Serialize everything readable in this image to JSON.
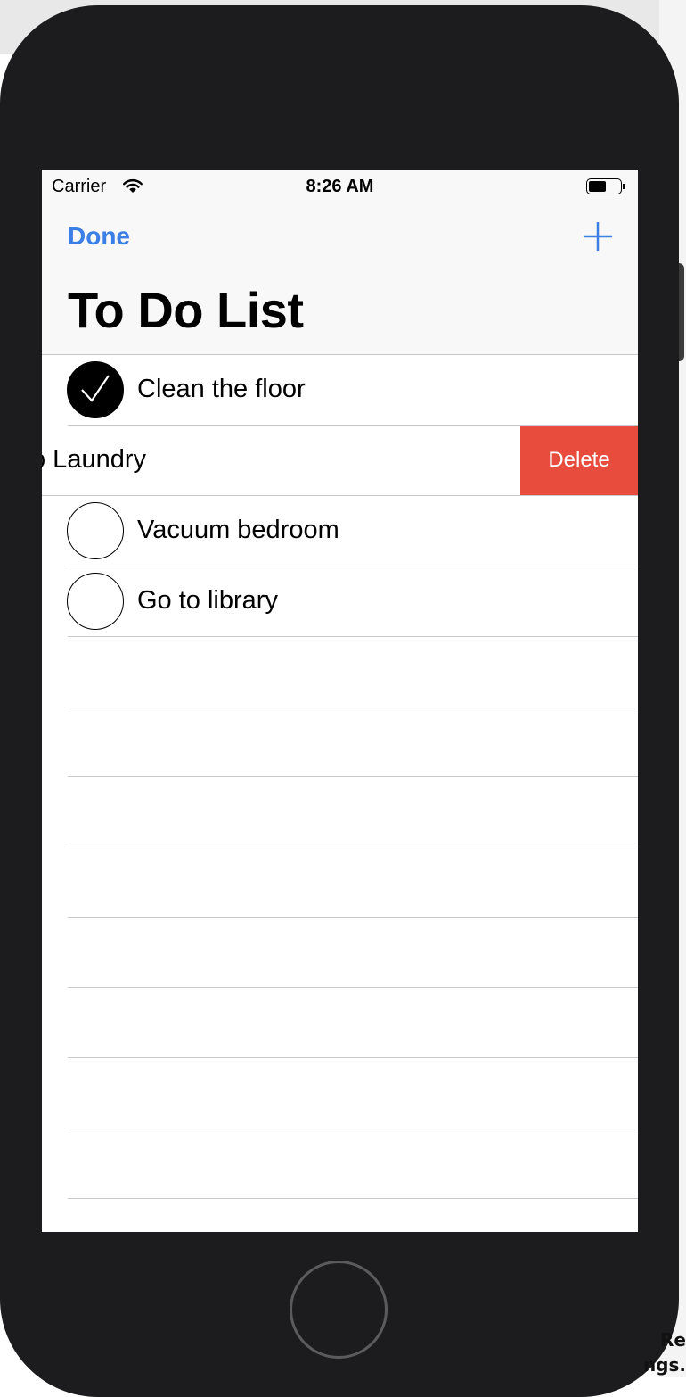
{
  "status_bar": {
    "carrier": "Carrier",
    "time": "8:26 AM"
  },
  "nav": {
    "done_label": "Done",
    "title": "To Do List"
  },
  "items": [
    {
      "label": "Clean the floor",
      "checked": true
    },
    {
      "label": "Do Laundry",
      "visible_label": "o Laundry",
      "checked": false,
      "delete_label": "Delete"
    },
    {
      "label": "Vacuum bedroom",
      "checked": false
    },
    {
      "label": "Go to library",
      "checked": false
    }
  ],
  "background_text": [
    "Re",
    "ngs."
  ],
  "colors": {
    "accent": "#3a7ee6",
    "delete": "#e74c3c",
    "bezel": "#1c1c1e"
  }
}
